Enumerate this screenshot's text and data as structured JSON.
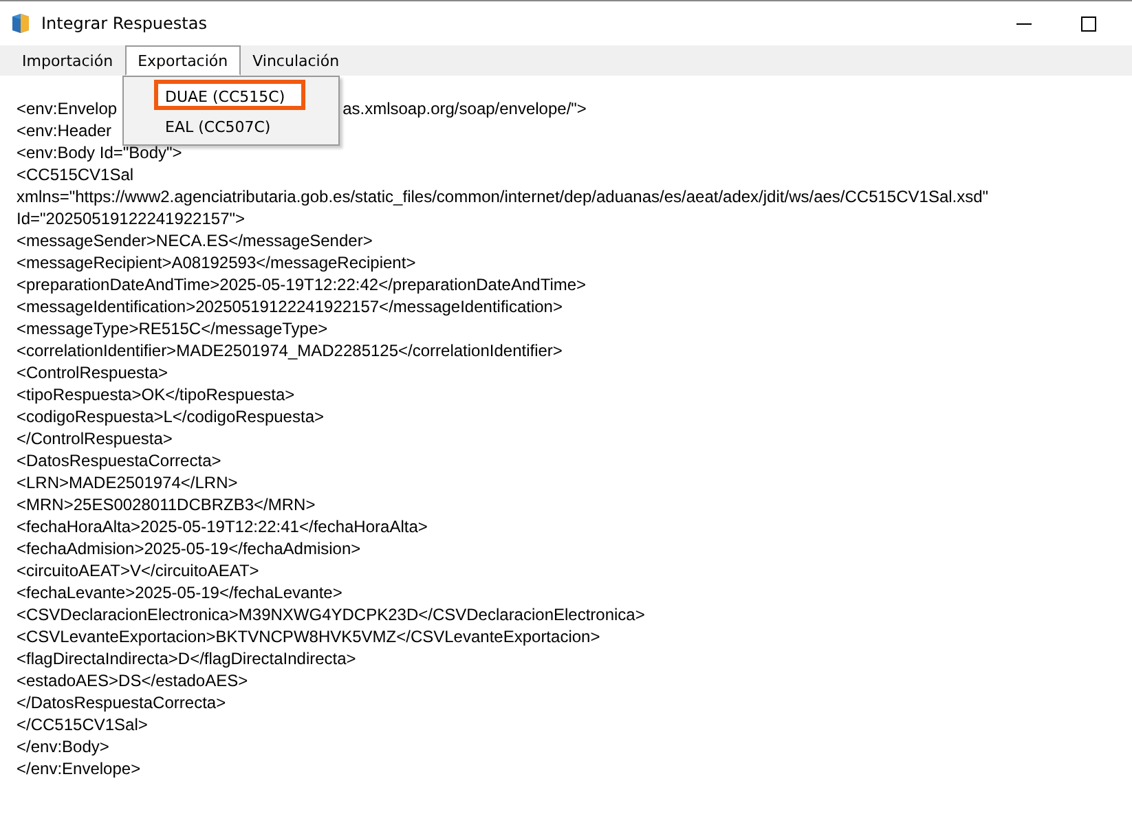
{
  "window": {
    "title": "Integrar Respuestas"
  },
  "menu_bar": [
    {
      "label": "Importación",
      "selected": false
    },
    {
      "label": "Exportación",
      "selected": true
    },
    {
      "label": "Vinculación",
      "selected": false
    }
  ],
  "dropdown": {
    "items": [
      {
        "label": "DUAE (CC515C)",
        "highlighted": true
      },
      {
        "label": "EAL (CC507C)",
        "highlighted": false
      }
    ]
  },
  "content_lines": [
    {
      "parts": [
        "<env:Envelop",
        "as.xmlsoap.org/soap/envelope/\">"
      ]
    },
    {
      "parts": [
        "<env:Header"
      ]
    },
    {
      "parts": [
        "<env:Body Id=\"Body\">"
      ]
    },
    {
      "parts": [
        "<CC515CV1Sal"
      ]
    },
    {
      "parts": [
        "xmlns=\"https://www2.agenciatributaria.gob.es/static_files/common/internet/dep/aduanas/es/aeat/adex/jdit/ws/aes/CC515CV1Sal.xsd\""
      ]
    },
    {
      "parts": [
        "Id=\"20250519122241922157\">"
      ]
    },
    {
      "parts": [
        "<messageSender>NECA.ES</messageSender>"
      ]
    },
    {
      "parts": [
        "<messageRecipient>A08192593</messageRecipient>"
      ]
    },
    {
      "parts": [
        "<preparationDateAndTime>2025-05-19T12:22:42</preparationDateAndTime>"
      ]
    },
    {
      "parts": [
        "<messageIdentification>20250519122241922157</messageIdentification>"
      ]
    },
    {
      "parts": [
        "<messageType>RE515C</messageType>"
      ]
    },
    {
      "parts": [
        "<correlationIdentifier>MADE2501974_MAD2285125</correlationIdentifier>"
      ]
    },
    {
      "parts": [
        "<ControlRespuesta>"
      ]
    },
    {
      "parts": [
        "<tipoRespuesta>OK</tipoRespuesta>"
      ]
    },
    {
      "parts": [
        "<codigoRespuesta>L</codigoRespuesta>"
      ]
    },
    {
      "parts": [
        "</ControlRespuesta>"
      ]
    },
    {
      "parts": [
        "<DatosRespuestaCorrecta>"
      ]
    },
    {
      "parts": [
        "<LRN>MADE2501974</LRN>"
      ]
    },
    {
      "parts": [
        "<MRN>25ES0028011DCBRZB3</MRN>"
      ]
    },
    {
      "parts": [
        "<fechaHoraAlta>2025-05-19T12:22:41</fechaHoraAlta>"
      ]
    },
    {
      "parts": [
        "<fechaAdmision>2025-05-19</fechaAdmision>"
      ]
    },
    {
      "parts": [
        "<circuitoAEAT>V</circuitoAEAT>"
      ]
    },
    {
      "parts": [
        "<fechaLevante>2025-05-19</fechaLevante>"
      ]
    },
    {
      "parts": [
        "<CSVDeclaracionElectronica>M39NXWG4YDCPK23D</CSVDeclaracionElectronica>"
      ]
    },
    {
      "parts": [
        "<CSVLevanteExportacion>BKTVNCPW8HVK5VMZ</CSVLevanteExportacion>"
      ]
    },
    {
      "parts": [
        "<flagDirectaIndirecta>D</flagDirectaIndirecta>"
      ]
    },
    {
      "parts": [
        "<estadoAES>DS</estadoAES>"
      ]
    },
    {
      "parts": [
        "</DatosRespuestaCorrecta>"
      ]
    },
    {
      "parts": [
        "</CC515CV1Sal>"
      ]
    },
    {
      "parts": [
        "</env:Body>"
      ]
    },
    {
      "parts": [
        "</env:Envelope>"
      ]
    }
  ]
}
